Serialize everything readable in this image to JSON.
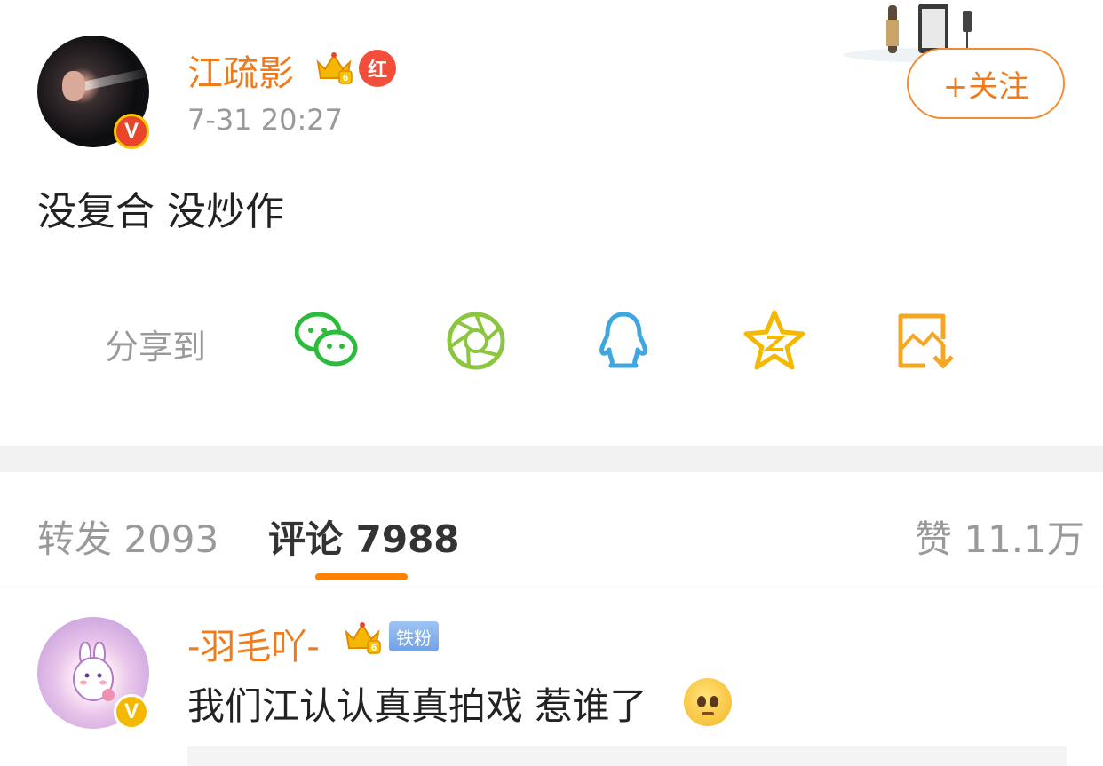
{
  "post": {
    "author": "江疏影",
    "crown_level": "6",
    "red_badge_label": "红",
    "verified_label": "V",
    "timestamp": "7-31 20:27",
    "follow_label": "+关注",
    "text": "没复合 没炒作"
  },
  "share": {
    "label": "分享到",
    "targets": [
      {
        "icon": "wechat-icon",
        "color": "#2dbb3b"
      },
      {
        "icon": "moments-icon",
        "color": "#8cc63e"
      },
      {
        "icon": "qq-icon",
        "color": "#40a6e0"
      },
      {
        "icon": "qzone-icon",
        "color": "#f5b800"
      },
      {
        "icon": "save-image-icon",
        "color": "#f5a623"
      }
    ]
  },
  "tabs": {
    "reposts": "转发 2093",
    "comments": "评论 7988",
    "likes": "赞 11.1万"
  },
  "comment": {
    "author": "-羽毛吖-",
    "crown_level": "6",
    "fan_badge": "铁粉",
    "verified_label": "V",
    "text": "我们江认认真真拍戏 惹谁了"
  },
  "colors": {
    "accent": "#ff8200",
    "username": "#f07b1c",
    "muted": "#999999"
  }
}
